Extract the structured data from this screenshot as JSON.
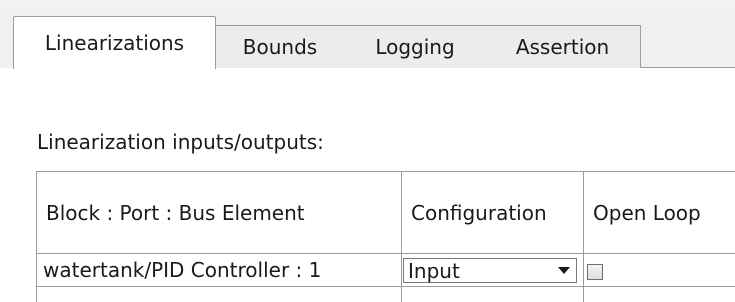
{
  "tabs": [
    {
      "label": "Linearizations",
      "active": true
    },
    {
      "label": "Bounds",
      "active": false
    },
    {
      "label": "Logging",
      "active": false
    },
    {
      "label": "Assertion",
      "active": false
    }
  ],
  "section_label": "Linearization inputs/outputs:",
  "table": {
    "headers": [
      "Block : Port : Bus Element",
      "Configuration",
      "Open Loop"
    ],
    "rows": [
      {
        "block": "watertank/PID Controller : 1",
        "configuration": "Input",
        "open_loop": false
      }
    ]
  }
}
